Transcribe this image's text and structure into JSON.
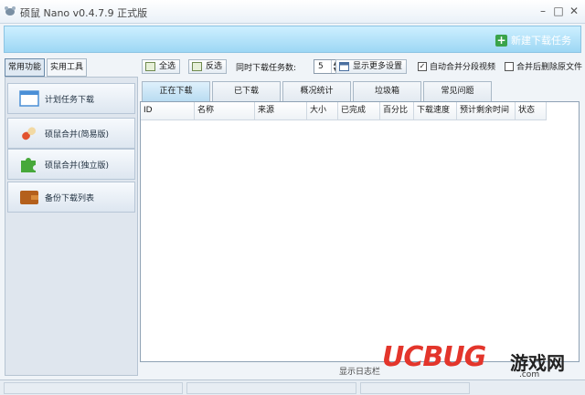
{
  "window": {
    "title": "硕鼠 Nano v0.4.7.9 正式版",
    "controls": {
      "minimize": "–",
      "maximize": "□",
      "close": "✕"
    }
  },
  "banner": {
    "new_task_label": "新建下载任务"
  },
  "left_tabs": [
    {
      "label": "常用功能",
      "active": true
    },
    {
      "label": "实用工具",
      "active": false
    }
  ],
  "left_menu": [
    {
      "label": "计划任务下载",
      "icon": "calendar-window-icon"
    },
    {
      "label": "硕鼠合并(简易版)",
      "icon": "capsule-icon"
    },
    {
      "label": "硕鼠合并(独立版)",
      "icon": "puzzle-icon"
    },
    {
      "label": "备份下载列表",
      "icon": "wallet-icon"
    }
  ],
  "toolbar": {
    "select_all": "全选",
    "invert_select": "反选",
    "concurrent_label": "同时下载任务数:",
    "concurrent_value": "5",
    "more_settings": "显示更多设置",
    "auto_merge": {
      "label": "自动合并分段视频",
      "checked": true
    },
    "delete_after_merge": {
      "label": "合并后删除原文件",
      "checked": false
    }
  },
  "tabs": [
    {
      "label": "正在下载",
      "active": true
    },
    {
      "label": "已下载",
      "active": false
    },
    {
      "label": "概况统计",
      "active": false
    },
    {
      "label": "垃圾箱",
      "active": false
    },
    {
      "label": "常见问题",
      "active": false
    }
  ],
  "columns": [
    "ID",
    "名称",
    "来源",
    "大小",
    "已完成",
    "百分比",
    "下载速度",
    "预计剩余时间",
    "状态"
  ],
  "log_toggle": "显示日志栏",
  "watermark": {
    "brand": "UCBUG",
    "cn": "游戏网",
    "domain": ".com"
  },
  "colors": {
    "accent": "#3aa34a",
    "banner": "#9dd7f4",
    "wm_red": "#e3352b",
    "wm_blue": "#1f8fd8"
  }
}
